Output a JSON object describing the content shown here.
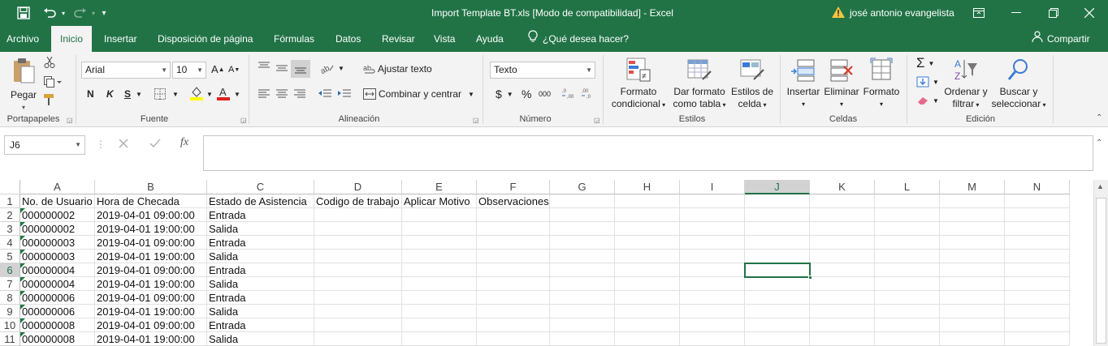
{
  "titlebar": {
    "title": "Import Template BT.xls  [Modo de compatibilidad]  -  Excel",
    "user": "josé antonio evangelista",
    "save_icon": "save-icon",
    "undo_icon": "undo-icon",
    "redo_icon": "redo-icon",
    "customize_icon": "customize-qat-icon",
    "warning_icon": "warning-icon",
    "ribbon_display_icon": "ribbon-display-icon",
    "minimize_icon": "minimize-icon",
    "restore_icon": "restore-icon",
    "close_icon": "close-icon"
  },
  "tabs": [
    {
      "label": "Archivo"
    },
    {
      "label": "Inicio"
    },
    {
      "label": "Insertar"
    },
    {
      "label": "Disposición de página"
    },
    {
      "label": "Fórmulas"
    },
    {
      "label": "Datos"
    },
    {
      "label": "Revisar"
    },
    {
      "label": "Vista"
    },
    {
      "label": "Ayuda"
    }
  ],
  "tell_me": "¿Qué desea hacer?",
  "share": "Compartir",
  "ribbon": {
    "groups": {
      "clipboard": "Portapapeles",
      "font": "Fuente",
      "alignment": "Alineación",
      "number": "Número",
      "styles": "Estilos",
      "cells": "Celdas",
      "editing": "Edición"
    },
    "paste": "Pegar",
    "font_name": "Arial",
    "font_size": "10",
    "bold": "N",
    "italic": "K",
    "underline": "S",
    "wrap_text": "Ajustar texto",
    "merge_center": "Combinar y centrar",
    "number_format": "Texto",
    "currency": "$",
    "percent": "%",
    "thousands": "000",
    "conditional_format_1": "Formato",
    "conditional_format_2": "condicional",
    "format_table_1": "Dar formato",
    "format_table_2": "como tabla",
    "cell_styles_1": "Estilos de",
    "cell_styles_2": "celda",
    "insert": "Insertar",
    "delete": "Eliminar",
    "format": "Formato",
    "sort_filter_1": "Ordenar y",
    "sort_filter_2": "filtrar",
    "find_select_1": "Buscar y",
    "find_select_2": "seleccionar"
  },
  "formula_bar": {
    "name_box": "J6",
    "fx": "fx",
    "formula": ""
  },
  "columns": [
    "A",
    "B",
    "C",
    "D",
    "E",
    "F",
    "G",
    "H",
    "I",
    "J",
    "K",
    "L",
    "M",
    "N"
  ],
  "selected_cell": "J6",
  "rows": [
    {
      "n": "1",
      "cells": [
        "No. de Usuario",
        "Hora de Checada",
        "Estado de Asistencia",
        "Codigo de trabajo",
        "Aplicar Motivo",
        "Observaciones"
      ]
    },
    {
      "n": "2",
      "cells": [
        "000000002",
        "2019-04-01 09:00:00",
        "Entrada",
        "",
        "",
        ""
      ]
    },
    {
      "n": "3",
      "cells": [
        "000000002",
        "2019-04-01 19:00:00",
        "Salida",
        "",
        "",
        ""
      ]
    },
    {
      "n": "4",
      "cells": [
        "000000003",
        "2019-04-01 09:00:00",
        "Entrada",
        "",
        "",
        ""
      ]
    },
    {
      "n": "5",
      "cells": [
        "000000003",
        "2019-04-01 19:00:00",
        "Salida",
        "",
        "",
        ""
      ]
    },
    {
      "n": "6",
      "cells": [
        "000000004",
        "2019-04-01 09:00:00",
        "Entrada",
        "",
        "",
        ""
      ]
    },
    {
      "n": "7",
      "cells": [
        "000000004",
        "2019-04-01 19:00:00",
        "Salida",
        "",
        "",
        ""
      ]
    },
    {
      "n": "8",
      "cells": [
        "000000006",
        "2019-04-01 09:00:00",
        "Entrada",
        "",
        "",
        ""
      ]
    },
    {
      "n": "9",
      "cells": [
        "000000006",
        "2019-04-01 19:00:00",
        "Salida",
        "",
        "",
        ""
      ]
    },
    {
      "n": "10",
      "cells": [
        "000000008",
        "2019-04-01 09:00:00",
        "Entrada",
        "",
        "",
        ""
      ]
    },
    {
      "n": "11",
      "cells": [
        "000000008",
        "2019-04-01 19:00:00",
        "Salida",
        "",
        "",
        ""
      ]
    }
  ],
  "colors": {
    "accent": "#217346",
    "ribbon_bg": "#f3f3f3",
    "text_marker": "#1f7a3f"
  }
}
